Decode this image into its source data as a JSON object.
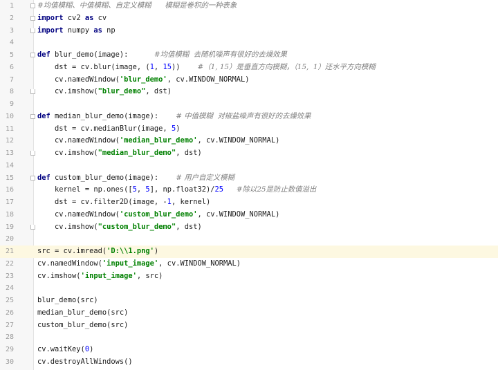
{
  "editor": {
    "language": "python",
    "current_line": 21,
    "lines": [
      {
        "n": "1",
        "fold": "start",
        "tokens": [
          {
            "t": "#均值模糊、中值模糊、自定义模糊      模糊是卷积的一种表象",
            "c": "cm"
          }
        ]
      },
      {
        "n": "2",
        "fold": "start",
        "tokens": [
          {
            "t": "import",
            "c": "kw"
          },
          {
            "t": " cv2 "
          },
          {
            "t": "as",
            "c": "kw"
          },
          {
            "t": " cv"
          }
        ]
      },
      {
        "n": "3",
        "fold": "end",
        "tokens": [
          {
            "t": "import",
            "c": "kw"
          },
          {
            "t": " numpy "
          },
          {
            "t": "as",
            "c": "kw"
          },
          {
            "t": " np"
          }
        ]
      },
      {
        "n": "4",
        "tokens": []
      },
      {
        "n": "5",
        "fold": "start",
        "tokens": [
          {
            "t": "def",
            "c": "kw"
          },
          {
            "t": " blur_demo(image):      "
          },
          {
            "t": "#均值模糊  去随机噪声有很好的去燥效果",
            "c": "cm"
          }
        ]
      },
      {
        "n": "6",
        "tokens": [
          {
            "t": "    dst = cv.blur(image, ("
          },
          {
            "t": "1",
            "c": "num"
          },
          {
            "t": ", "
          },
          {
            "t": "15",
            "c": "num"
          },
          {
            "t": "))    "
          },
          {
            "t": "#（1, 15）是垂直方向模糊，（15,  1）还水平方向模糊",
            "c": "cm"
          }
        ]
      },
      {
        "n": "7",
        "tokens": [
          {
            "t": "    cv.namedWindow("
          },
          {
            "t": "'blur_demo'",
            "c": "str"
          },
          {
            "t": ", cv.WINDOW_NORMAL)"
          }
        ]
      },
      {
        "n": "8",
        "fold": "end",
        "tokens": [
          {
            "t": "    cv.imshow("
          },
          {
            "t": "\"blur_demo\"",
            "c": "str"
          },
          {
            "t": ", dst)"
          }
        ]
      },
      {
        "n": "9",
        "tokens": []
      },
      {
        "n": "10",
        "fold": "start",
        "tokens": [
          {
            "t": "def",
            "c": "kw"
          },
          {
            "t": " median_blur_demo(image):    "
          },
          {
            "t": "# 中值模糊  对椒盐噪声有很好的去燥效果",
            "c": "cm"
          }
        ]
      },
      {
        "n": "11",
        "tokens": [
          {
            "t": "    dst = cv.medianBlur(image, "
          },
          {
            "t": "5",
            "c": "num"
          },
          {
            "t": ")"
          }
        ]
      },
      {
        "n": "12",
        "tokens": [
          {
            "t": "    cv.namedWindow("
          },
          {
            "t": "'median_blur_demo'",
            "c": "str"
          },
          {
            "t": ", cv.WINDOW_NORMAL)"
          }
        ]
      },
      {
        "n": "13",
        "fold": "end",
        "tokens": [
          {
            "t": "    cv.imshow("
          },
          {
            "t": "\"median_blur_demo\"",
            "c": "str"
          },
          {
            "t": ", dst)"
          }
        ]
      },
      {
        "n": "14",
        "tokens": []
      },
      {
        "n": "15",
        "fold": "start",
        "tokens": [
          {
            "t": "def",
            "c": "kw"
          },
          {
            "t": " custom_blur_demo(image):    "
          },
          {
            "t": "# 用户自定义模糊",
            "c": "cm"
          }
        ]
      },
      {
        "n": "16",
        "tokens": [
          {
            "t": "    kernel = np.ones(["
          },
          {
            "t": "5",
            "c": "num"
          },
          {
            "t": ", "
          },
          {
            "t": "5",
            "c": "num"
          },
          {
            "t": "], np.float32)/"
          },
          {
            "t": "25",
            "c": "num"
          },
          {
            "t": "   "
          },
          {
            "t": "#除以25是防止数值溢出",
            "c": "cm"
          }
        ]
      },
      {
        "n": "17",
        "tokens": [
          {
            "t": "    dst = cv.filter2D(image, -"
          },
          {
            "t": "1",
            "c": "num"
          },
          {
            "t": ", kernel)"
          }
        ]
      },
      {
        "n": "18",
        "tokens": [
          {
            "t": "    cv.namedWindow("
          },
          {
            "t": "'custom_blur_demo'",
            "c": "str"
          },
          {
            "t": ", cv.WINDOW_NORMAL)"
          }
        ]
      },
      {
        "n": "19",
        "fold": "end",
        "tokens": [
          {
            "t": "    cv.imshow("
          },
          {
            "t": "\"custom_blur_demo\"",
            "c": "str"
          },
          {
            "t": ", dst)"
          }
        ]
      },
      {
        "n": "20",
        "tokens": []
      },
      {
        "n": "21",
        "tokens": [
          {
            "t": "src = cv.imread("
          },
          {
            "t": "'D:\\\\1.png'",
            "c": "str"
          },
          {
            "t": ")"
          }
        ]
      },
      {
        "n": "22",
        "tokens": [
          {
            "t": "cv.namedWindow("
          },
          {
            "t": "'input_image'",
            "c": "str"
          },
          {
            "t": ", cv.WINDOW_NORMAL)"
          }
        ]
      },
      {
        "n": "23",
        "tokens": [
          {
            "t": "cv.imshow("
          },
          {
            "t": "'input_image'",
            "c": "str"
          },
          {
            "t": ", src)"
          }
        ]
      },
      {
        "n": "24",
        "tokens": []
      },
      {
        "n": "25",
        "tokens": [
          {
            "t": "blur_demo(src)"
          }
        ]
      },
      {
        "n": "26",
        "tokens": [
          {
            "t": "median_blur_demo(src)"
          }
        ]
      },
      {
        "n": "27",
        "tokens": [
          {
            "t": "custom_blur_demo(src)"
          }
        ]
      },
      {
        "n": "28",
        "tokens": []
      },
      {
        "n": "29",
        "tokens": [
          {
            "t": "cv.waitKey("
          },
          {
            "t": "0",
            "c": "num"
          },
          {
            "t": ")"
          }
        ]
      },
      {
        "n": "30",
        "tokens": [
          {
            "t": "cv.destroyAllWindows()"
          }
        ]
      }
    ]
  }
}
